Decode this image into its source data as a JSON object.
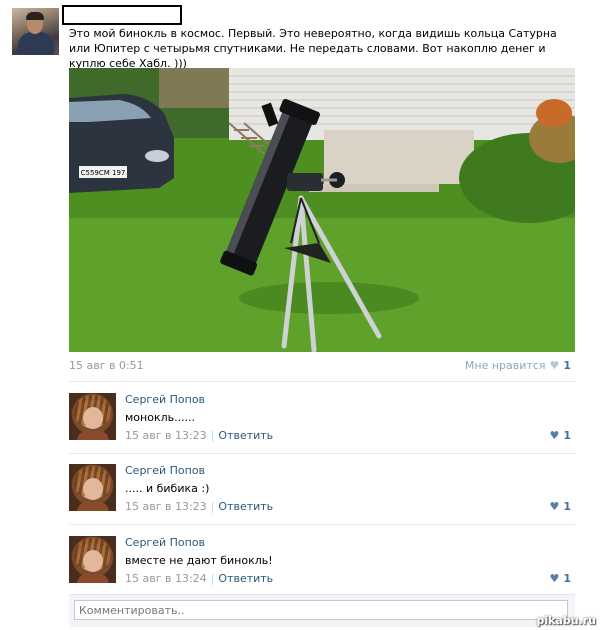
{
  "post": {
    "text": "Это мой бинокль в космос. Первый. Это невероятно, когда видишь кольца Сатурна или Юпитер с четырьмя спутниками. Не передать словами. Вот накоплю денег и куплю себе Хабл. )))",
    "date": "15 авг в 0:51",
    "like_label": "Мне нравится",
    "like_count": "1",
    "photo_plate": "С559СМ 197"
  },
  "comments": [
    {
      "author": "Сергей Попов",
      "text": "монокль......",
      "date": "15 авг в 13:23",
      "reply": "Ответить",
      "likes": "1"
    },
    {
      "author": "Сергей Попов",
      "text": "..... и бибика :)",
      "date": "15 авг в 13:23",
      "reply": "Ответить",
      "likes": "1"
    },
    {
      "author": "Сергей Попов",
      "text": "вместе не дают бинокль!",
      "date": "15 авг в 13:24",
      "reply": "Ответить",
      "likes": "1"
    }
  ],
  "comment_form": {
    "placeholder": "Комментировать.."
  },
  "watermark": "pikabu.ru",
  "icons": {
    "like": "heart-icon"
  },
  "colors": {
    "link": "#2b587a",
    "meta": "#999999",
    "divider": "#e7eaed"
  }
}
